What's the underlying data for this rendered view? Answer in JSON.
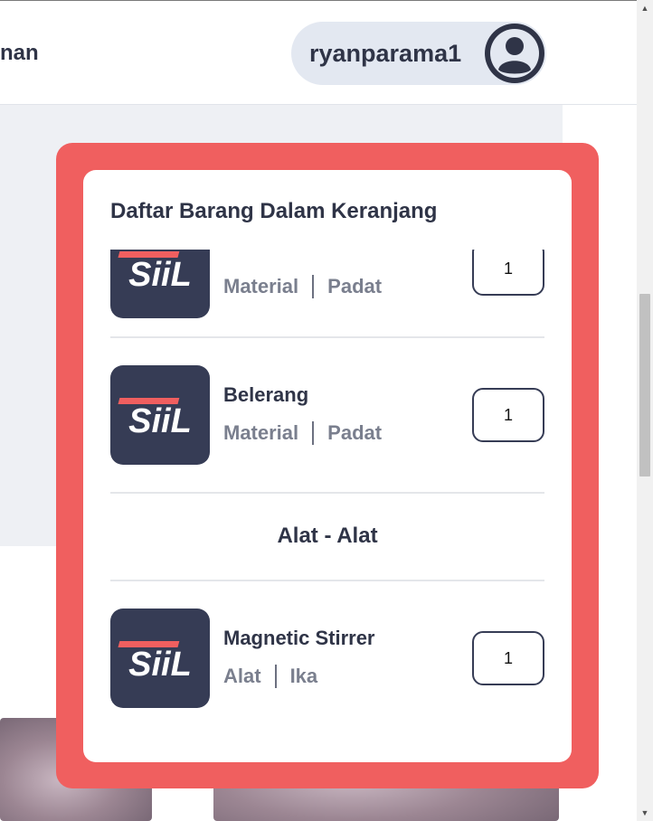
{
  "header": {
    "nav_fragment": "nan",
    "username": "ryanparama1"
  },
  "modal": {
    "title": "Daftar Barang Dalam Keranjang",
    "items": [
      {
        "name": "",
        "category": "Material",
        "subcategory": "Padat",
        "quantity": "1",
        "logo_text": "SiiL"
      },
      {
        "name": "Belerang",
        "category": "Material",
        "subcategory": "Padat",
        "quantity": "1",
        "logo_text": "SiiL"
      },
      {
        "name": "Magnetic Stirrer",
        "category": "Alat",
        "subcategory": "Ika",
        "quantity": "1",
        "logo_text": "SiiL"
      }
    ],
    "section_heading": "Alat - Alat"
  },
  "colors": {
    "modal_border": "#f05f5f",
    "primary_text": "#2f3447",
    "logo_background": "#363c55",
    "logo_accent": "#f05f5f"
  }
}
